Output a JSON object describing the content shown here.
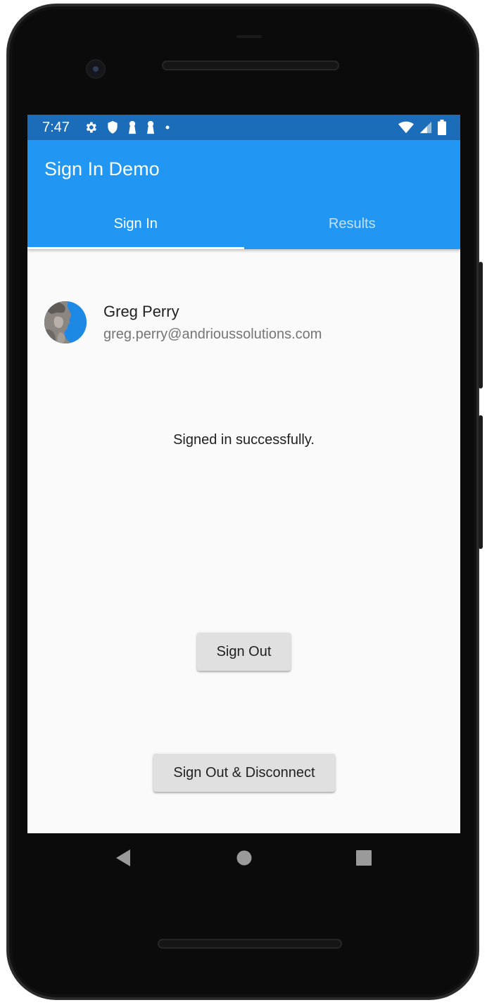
{
  "status_bar": {
    "time": "7:47",
    "color": "#1c6db9",
    "left_icons": [
      "gear-icon",
      "shield-icon",
      "keyhole-icon",
      "keyhole-icon",
      "dot-icon"
    ],
    "right_icons": [
      "wifi-icon",
      "signal-icon",
      "battery-icon"
    ]
  },
  "app_bar": {
    "title": "Sign In Demo",
    "color": "#2196f3"
  },
  "tabs": [
    {
      "label": "Sign In",
      "active": true
    },
    {
      "label": "Results",
      "active": false
    }
  ],
  "user": {
    "name": "Greg Perry",
    "email": "greg.perry@andrioussolutions.com",
    "avatar": "statue-avatar"
  },
  "message": "Signed in successfully.",
  "buttons": {
    "sign_out": "Sign Out",
    "sign_out_disconnect": "Sign Out & Disconnect"
  },
  "nav_bar": {
    "icons": [
      "back-icon",
      "home-icon",
      "recents-icon"
    ]
  }
}
